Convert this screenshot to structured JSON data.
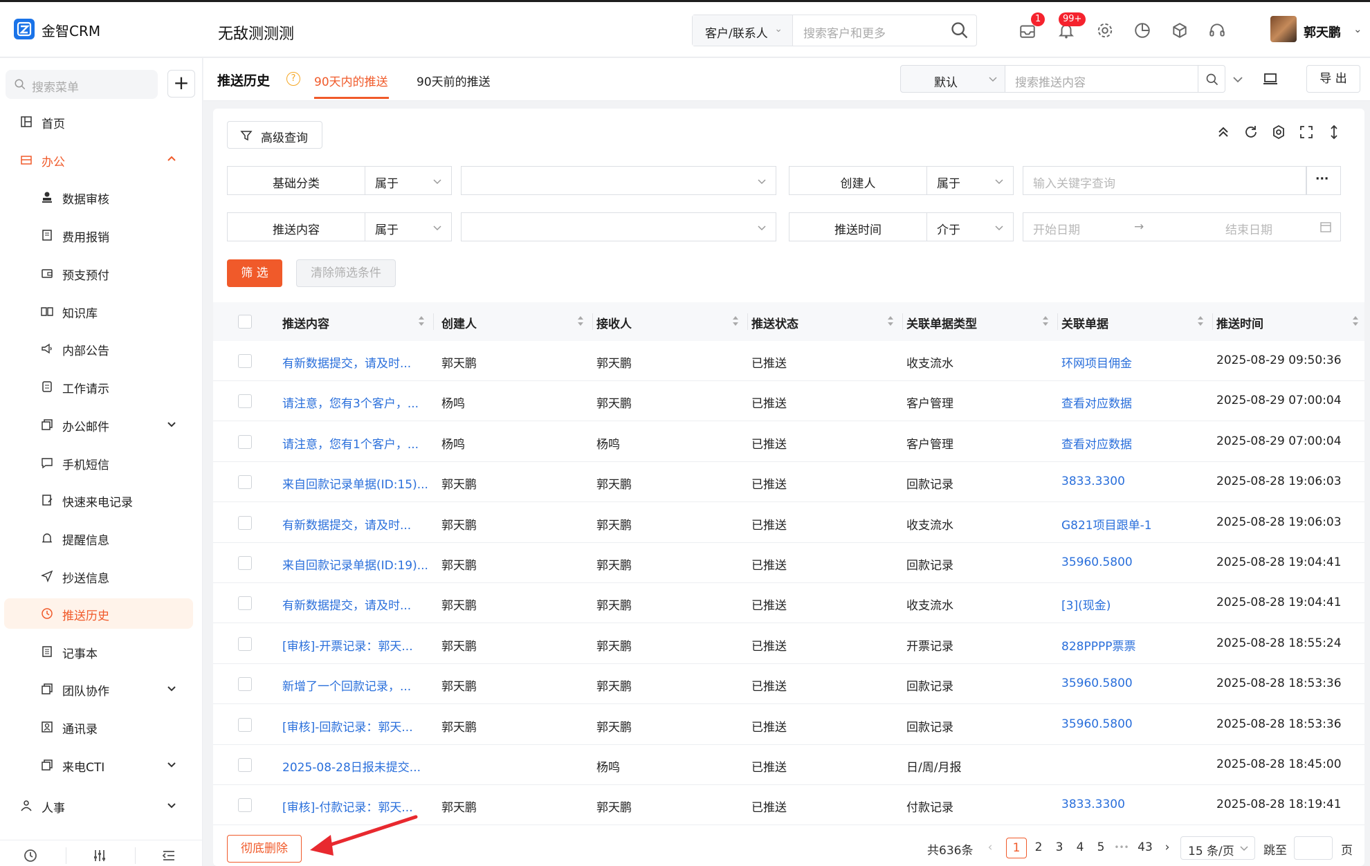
{
  "app": {
    "logo_letter": "iZ",
    "brand": "金智CRM",
    "workspace": "无敌测测测",
    "search_scope": "客户/联系人",
    "search_placeholder": "搜索客户和更多",
    "badge_mail": "1",
    "badge_bell": "99+",
    "user_name": "郭天鹏"
  },
  "sidebar": {
    "search_placeholder": "搜索菜单",
    "items": [
      {
        "label": "首页",
        "icon": "dashboard-icon"
      },
      {
        "label": "办公",
        "icon": "office-icon"
      },
      {
        "label": "数据审核",
        "icon": "stamp-icon"
      },
      {
        "label": "费用报销",
        "icon": "receipt-icon"
      },
      {
        "label": "预支预付",
        "icon": "wallet-icon"
      },
      {
        "label": "知识库",
        "icon": "book-icon"
      },
      {
        "label": "内部公告",
        "icon": "megaphone-icon"
      },
      {
        "label": "工作请示",
        "icon": "document-icon"
      },
      {
        "label": "办公邮件",
        "icon": "copy-icon"
      },
      {
        "label": "手机短信",
        "icon": "chat-icon"
      },
      {
        "label": "快速来电记录",
        "icon": "edit-doc-icon"
      },
      {
        "label": "提醒信息",
        "icon": "bell-icon"
      },
      {
        "label": "抄送信息",
        "icon": "send-icon"
      },
      {
        "label": "推送历史",
        "icon": "clock-icon"
      },
      {
        "label": "记事本",
        "icon": "notebook-icon"
      },
      {
        "label": "团队协作",
        "icon": "copy-icon"
      },
      {
        "label": "通讯录",
        "icon": "contacts-icon"
      },
      {
        "label": "来电CTI",
        "icon": "copy-icon"
      },
      {
        "label": "人事",
        "icon": "person-icon"
      }
    ]
  },
  "content": {
    "title": "推送历史",
    "tabs": [
      "90天内的推送",
      "90天前的推送"
    ],
    "view_select": "默认",
    "search_placeholder": "搜索推送内容",
    "export_label": "导 出"
  },
  "filters": {
    "advanced_label": "高级查询",
    "rows": [
      [
        {
          "field": "基础分类",
          "op": "属于",
          "value": ""
        },
        {
          "field": "创建人",
          "op": "属于",
          "placeholder": "输入关键字查询"
        }
      ],
      [
        {
          "field": "推送内容",
          "op": "属于",
          "value": ""
        },
        {
          "field": "推送时间",
          "op": "介于",
          "start": "开始日期",
          "end": "结束日期",
          "arrow": "→"
        }
      ]
    ],
    "more_label": "···",
    "filter_btn": "筛 选",
    "clear_btn": "清除筛选条件"
  },
  "table": {
    "columns": [
      "推送内容",
      "创建人",
      "接收人",
      "推送状态",
      "关联单据类型",
      "关联单据",
      "推送时间"
    ],
    "rows": [
      [
        "有新数据提交，请及时...",
        "郭天鹏",
        "郭天鹏",
        "已推送",
        "收支流水",
        "环网项目佣金",
        "2025-08-29 09:50:36"
      ],
      [
        "请注意，您有3个客户，...",
        "杨鸣",
        "郭天鹏",
        "已推送",
        "客户管理",
        "查看对应数据",
        "2025-08-29 07:00:04"
      ],
      [
        "请注意，您有1个客户，...",
        "杨鸣",
        "杨鸣",
        "已推送",
        "客户管理",
        "查看对应数据",
        "2025-08-29 07:00:04"
      ],
      [
        "来自回款记录单据(ID:15)...",
        "郭天鹏",
        "郭天鹏",
        "已推送",
        "回款记录",
        "3833.3300",
        "2025-08-28 19:06:03"
      ],
      [
        "有新数据提交，请及时...",
        "郭天鹏",
        "郭天鹏",
        "已推送",
        "收支流水",
        "G821项目跟单-1",
        "2025-08-28 19:06:03"
      ],
      [
        "来自回款记录单据(ID:19)...",
        "郭天鹏",
        "郭天鹏",
        "已推送",
        "回款记录",
        "35960.5800",
        "2025-08-28 19:04:41"
      ],
      [
        "有新数据提交，请及时...",
        "郭天鹏",
        "郭天鹏",
        "已推送",
        "收支流水",
        "[3](现金)",
        "2025-08-28 19:04:41"
      ],
      [
        "[审核]-开票记录：郭天...",
        "郭天鹏",
        "郭天鹏",
        "已推送",
        "开票记录",
        "828PPPP票票",
        "2025-08-28 18:55:24"
      ],
      [
        "新增了一个回款记录，...",
        "郭天鹏",
        "郭天鹏",
        "已推送",
        "回款记录",
        "35960.5800",
        "2025-08-28 18:53:36"
      ],
      [
        "[审核]-回款记录：郭天...",
        "郭天鹏",
        "郭天鹏",
        "已推送",
        "回款记录",
        "35960.5800",
        "2025-08-28 18:53:36"
      ],
      [
        "2025-08-28日报未提交...",
        "",
        "杨鸣",
        "已推送",
        "日/周/月报",
        "",
        "2025-08-28 18:45:00"
      ],
      [
        "[审核]-付款记录：郭天...",
        "郭天鹏",
        "郭天鹏",
        "已推送",
        "付款记录",
        "3833.3300",
        "2025-08-28 18:19:41"
      ]
    ]
  },
  "footer": {
    "delete_label": "彻底删除",
    "total": "共636条",
    "pages": [
      "1",
      "2",
      "3",
      "4",
      "5",
      "•••",
      "43"
    ],
    "page_size": "15 条/页",
    "jump_label": "跳至",
    "page_suffix": "页"
  }
}
